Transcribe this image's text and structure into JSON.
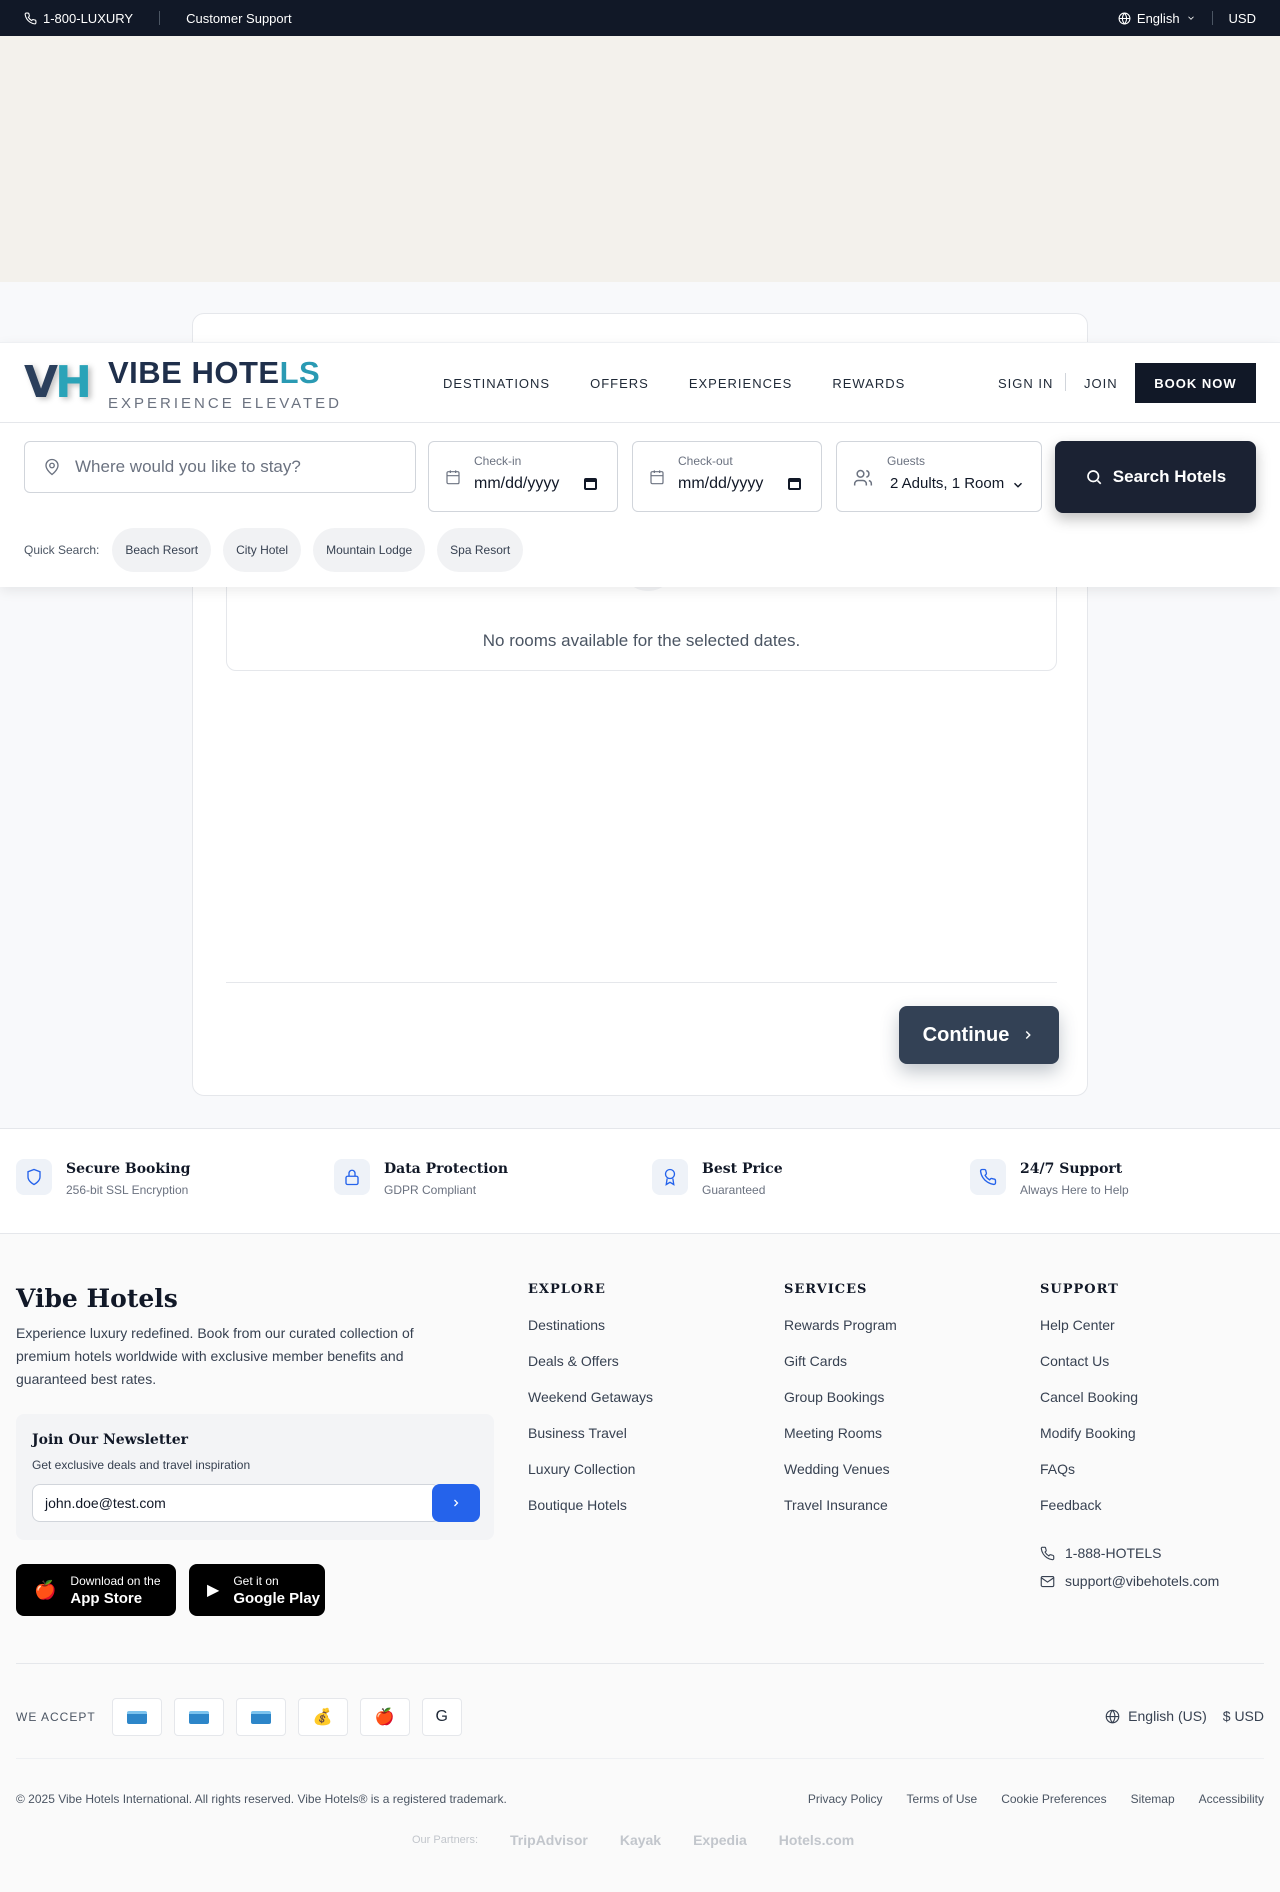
{
  "topbar": {
    "phone": "1-800-LUXURY",
    "support": "Customer Support",
    "language": "English",
    "currency": "USD"
  },
  "brand": {
    "mark_v": "V",
    "mark_h": "H",
    "name_main": "VIBE HOTE",
    "name_accent": "LS",
    "tagline": "EXPERIENCE ELEVATED"
  },
  "nav": {
    "links": [
      "DESTINATIONS",
      "OFFERS",
      "EXPERIENCES",
      "REWARDS"
    ],
    "sign_in": "SIGN IN",
    "join": "JOIN",
    "book_now": "BOOK NOW"
  },
  "search": {
    "location_placeholder": "Where would you like to stay?",
    "checkin_label": "Check-in",
    "checkin_value": "mm/dd/yyyy",
    "checkout_label": "Check-out",
    "checkout_value": "mm/dd/yyyy",
    "guests_label": "Guests",
    "guests_value": "2 Adults, 1 Room",
    "button": "Search Hotels",
    "quick_label": "Quick Search:",
    "quick_chips": [
      "Beach Resort",
      "City Hotel",
      "Mountain Lodge",
      "Spa Resort"
    ]
  },
  "booking": {
    "empty_message": "No rooms available for the selected dates.",
    "continue": "Continue"
  },
  "trust": [
    {
      "title": "Secure Booking",
      "sub": "256-bit SSL Encryption",
      "icon": "shield-icon"
    },
    {
      "title": "Data Protection",
      "sub": "GDPR Compliant",
      "icon": "lock-icon"
    },
    {
      "title": "Best Price",
      "sub": "Guaranteed",
      "icon": "award-icon"
    },
    {
      "title": "24/7 Support",
      "sub": "Always Here to Help",
      "icon": "phone-icon"
    }
  ],
  "footer": {
    "brand": "Vibe Hotels",
    "description": "Experience luxury redefined. Book from our curated collection of premium hotels worldwide with exclusive member benefits and guaranteed best rates.",
    "newsletter": {
      "title": "Join Our Newsletter",
      "sub": "Get exclusive deals and travel inspiration",
      "email": "john.doe@test.com"
    },
    "app_store": {
      "small": "Download on the",
      "large": "App Store"
    },
    "google_play": {
      "small": "Get it on",
      "large": "Google Play"
    },
    "columns": [
      {
        "title": "EXPLORE",
        "links": [
          "Destinations",
          "Deals & Offers",
          "Weekend Getaways",
          "Business Travel",
          "Luxury Collection",
          "Boutique Hotels"
        ]
      },
      {
        "title": "SERVICES",
        "links": [
          "Rewards Program",
          "Gift Cards",
          "Group Bookings",
          "Meeting Rooms",
          "Wedding Venues",
          "Travel Insurance"
        ]
      },
      {
        "title": "SUPPORT",
        "links": [
          "Help Center",
          "Contact Us",
          "Cancel Booking",
          "Modify Booking",
          "FAQs",
          "Feedback"
        ]
      }
    ],
    "phone": "1-888-HOTELS",
    "email": "support@vibehotels.com",
    "we_accept": "WE ACCEPT",
    "language": "English (US)",
    "currency": "$ USD",
    "copyright": "© 2025 Vibe Hotels International. All rights reserved. Vibe Hotels® is a registered trademark.",
    "legal": [
      "Privacy Policy",
      "Terms of Use",
      "Cookie Preferences",
      "Sitemap",
      "Accessibility"
    ],
    "partners_label": "Our Partners:",
    "partners": [
      "TripAdvisor",
      "Kayak",
      "Expedia",
      "Hotels.com"
    ]
  },
  "colors": {
    "navy": "#111827",
    "accent_blue": "#2563eb",
    "continue": "#334155",
    "teal": "#2a9ab3"
  }
}
